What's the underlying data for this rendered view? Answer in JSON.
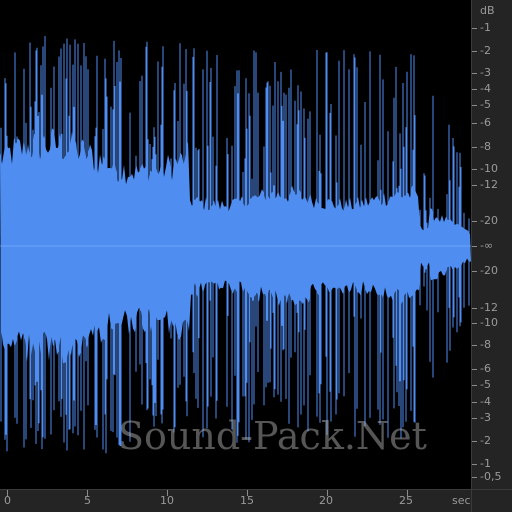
{
  "colors": {
    "waveform": "#4f8ef0",
    "background": "#000000",
    "ruler_bg": "#242424",
    "ruler_text": "#9a9a9a"
  },
  "db_ruler": {
    "unit": "dB",
    "labels": [
      "-1",
      "-2",
      "-3",
      "-4",
      "-5",
      "-6",
      "-8",
      "-10",
      "-12",
      "-20",
      "-∞",
      "-20",
      "-12",
      "-10",
      "-8",
      "-6",
      "-5",
      "-4",
      "-3",
      "-2",
      "-1",
      "-0,5"
    ]
  },
  "time_ruler": {
    "unit": "sec",
    "labels": [
      "0",
      "5",
      "10",
      "15",
      "20",
      "25"
    ],
    "seconds": [
      0,
      5,
      10,
      15,
      20,
      25
    ],
    "duration_sec": 29.3
  },
  "watermark": "Sound-Pack.Net"
}
